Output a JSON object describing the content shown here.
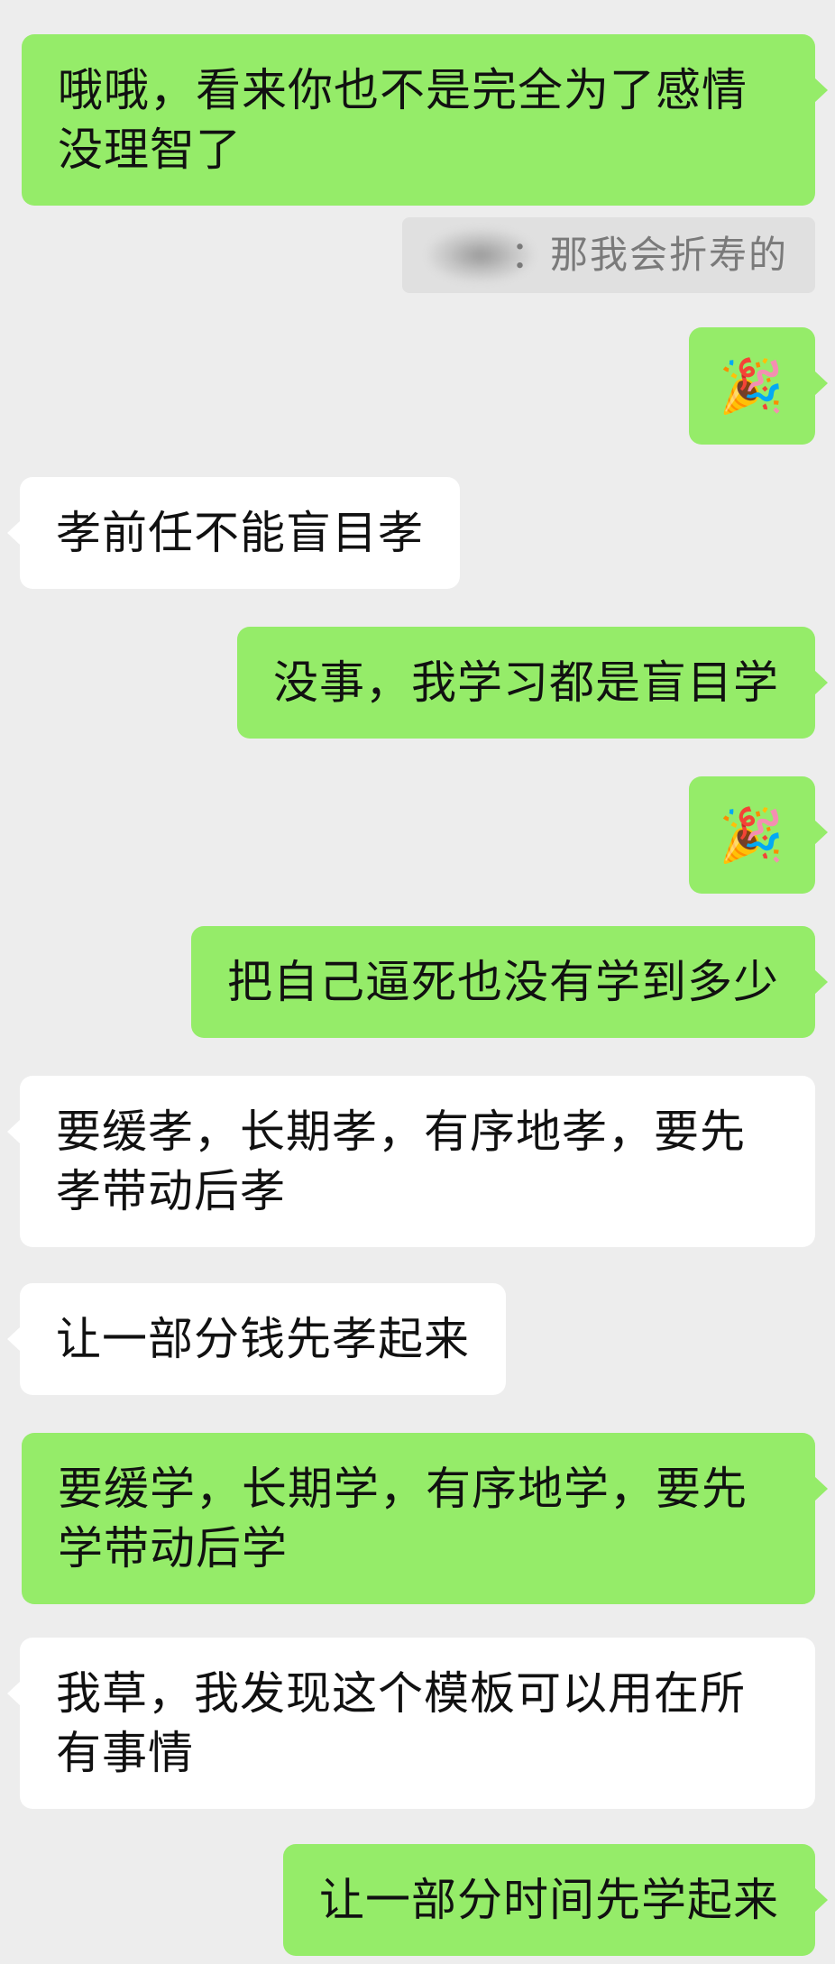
{
  "messages": [
    {
      "side": "right",
      "type": "text",
      "text": "哦哦，看来你也不是完全为了感情没理智了"
    },
    {
      "side": "right",
      "type": "quote",
      "quote_text": "：那我会折寿的"
    },
    {
      "side": "right",
      "type": "emoji",
      "icon": "party-popper-icon",
      "text": "🎉"
    },
    {
      "side": "left",
      "type": "text",
      "text": "孝前任不能盲目孝"
    },
    {
      "side": "right",
      "type": "text",
      "text": "没事，我学习都是盲目学"
    },
    {
      "side": "right",
      "type": "emoji",
      "icon": "party-popper-icon",
      "text": "🎉"
    },
    {
      "side": "right",
      "type": "text",
      "text": "把自己逼死也没有学到多少"
    },
    {
      "side": "left",
      "type": "text",
      "text": "要缓孝，长期孝，有序地孝，要先孝带动后孝"
    },
    {
      "side": "left",
      "type": "text",
      "text": "让一部分钱先孝起来"
    },
    {
      "side": "right",
      "type": "text",
      "text": "要缓学，长期学，有序地学，要先学带动后学"
    },
    {
      "side": "left",
      "type": "text",
      "text": "我草，我发现这个模板可以用在所有事情"
    },
    {
      "side": "right",
      "type": "text",
      "text": "让一部分时间先学起来"
    }
  ],
  "colors": {
    "background": "#ededed",
    "outgoing_bubble": "#95ec69",
    "incoming_bubble": "#ffffff",
    "quote_background": "#e0e0e0",
    "quote_text": "#7a7a7a"
  }
}
